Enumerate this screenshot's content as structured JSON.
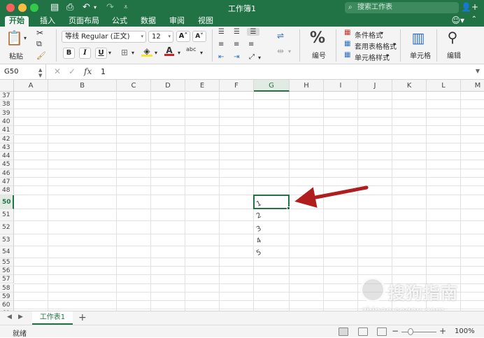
{
  "window": {
    "title": "工作簿1"
  },
  "search": {
    "placeholder": "搜索工作表"
  },
  "tabs": [
    "开始",
    "插入",
    "页面布局",
    "公式",
    "数据",
    "审阅",
    "视图"
  ],
  "ribbon": {
    "paste_label": "粘贴",
    "font_name": "等线 Regular (正文)",
    "font_size": "12",
    "bold": "B",
    "italic": "I",
    "underline": "U",
    "grow_font": "A",
    "shrink_font": "A",
    "abc": "abc",
    "number_label": "编号",
    "number_symbol": "%",
    "conditional_format": "条件格式",
    "table_format": "套用表格格式",
    "cell_styles": "单元格样式",
    "cells_label": "单元格",
    "editing_label": "编辑"
  },
  "formula_bar": {
    "name_box": "G50",
    "value": "1",
    "fx": "fx"
  },
  "columns": [
    "A",
    "B",
    "C",
    "D",
    "E",
    "F",
    "G",
    "H",
    "I",
    "J",
    "K",
    "L",
    "M"
  ],
  "selected_column": "G",
  "rows": [
    "37",
    "38",
    "39",
    "40",
    "41",
    "42",
    "43",
    "44",
    "45",
    "46",
    "47",
    "48",
    "50",
    "51",
    "52",
    "53",
    "54",
    "55",
    "56",
    "57",
    "58",
    "59",
    "60",
    "61"
  ],
  "selected_row": "50",
  "cell_values": {
    "G50": "1",
    "G51": "2",
    "G52": "3",
    "G53": "4",
    "G54": "5"
  },
  "sheet": {
    "name": "工作表1",
    "add": "+"
  },
  "status": {
    "text": "就绪",
    "zoom": "100%"
  },
  "watermark": {
    "text": "搜狗指南",
    "url": "zhinan.sogou.com"
  },
  "colors": {
    "accent": "#217346",
    "arrow": "#b01d1d"
  }
}
